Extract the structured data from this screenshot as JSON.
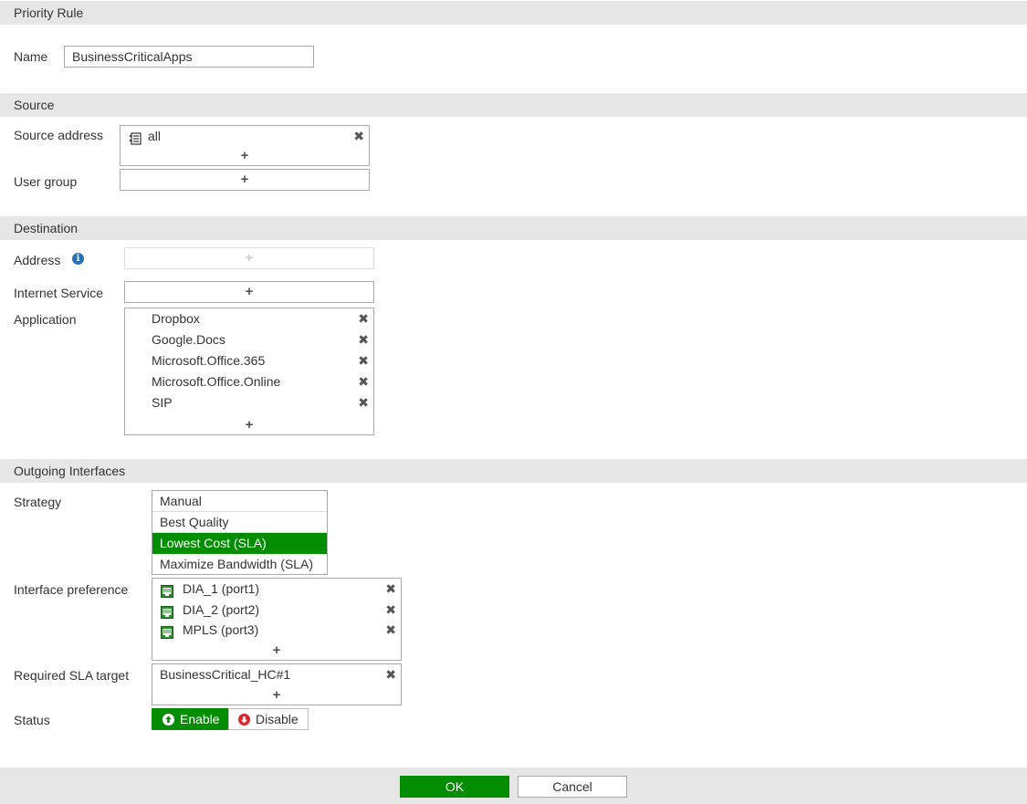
{
  "form": {
    "title": "Priority Rule",
    "name_label": "Name",
    "name_value": "BusinessCriticalApps"
  },
  "source": {
    "header": "Source",
    "address_label": "Source address",
    "addresses": [
      "all"
    ],
    "user_group_label": "User group",
    "add_symbol": "+",
    "remove_symbol": "✖"
  },
  "destination": {
    "header": "Destination",
    "address_label": "Address",
    "internet_service_label": "Internet Service",
    "application_label": "Application",
    "applications": [
      "Dropbox",
      "Google.Docs",
      "Microsoft.Office.365",
      "Microsoft.Office.Online",
      "SIP"
    ]
  },
  "outgoing": {
    "header": "Outgoing Interfaces",
    "strategy_label": "Strategy",
    "strategies": [
      "Manual",
      "Best Quality",
      "Lowest Cost (SLA)",
      "Maximize Bandwidth (SLA)"
    ],
    "selected_strategy": "Lowest Cost (SLA)",
    "interface_preference_label": "Interface preference",
    "interfaces": [
      "DIA_1 (port1)",
      "DIA_2 (port2)",
      "MPLS (port3)"
    ],
    "sla_label": "Required SLA target",
    "sla_targets": [
      "BusinessCritical_HC#1"
    ],
    "status_label": "Status",
    "status_enable": "Enable",
    "status_disable": "Disable",
    "status_value": "Enable"
  },
  "buttons": {
    "ok": "OK",
    "cancel": "Cancel"
  },
  "colors": {
    "accent_green": "#038d03",
    "header_bg": "#e6e6e6",
    "disable_red": "#d9262c",
    "info_blue": "#2a6fb5"
  }
}
